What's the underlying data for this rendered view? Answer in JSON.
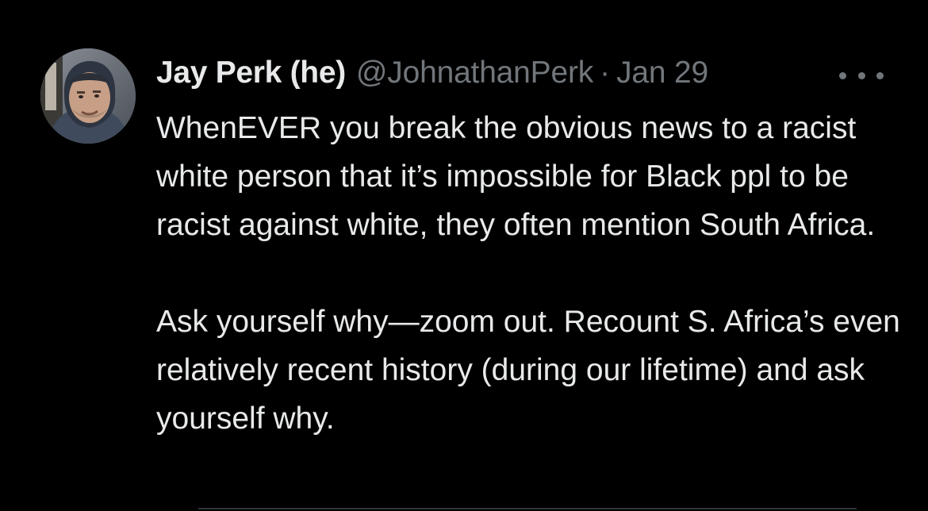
{
  "tweet": {
    "author": {
      "display_name": "Jay Perk (he)",
      "handle": "@JohnathanPerk",
      "avatar_icon": "user-avatar-photo"
    },
    "separator": "·",
    "date": "Jan 29",
    "more_icon": "more-horizontal-icon",
    "paragraphs": [
      "WhenEVER you break the obvious news to a racist white person that it’s impossible for Black ppl to be racist against white, they often mention South Africa.",
      "Ask yourself why—zoom out. Recount S. Africa’s even relatively recent history (during our lifetime) and ask yourself why."
    ]
  },
  "colors": {
    "background": "#000000",
    "primary_text": "#e7e9ea",
    "secondary_text": "#71767b"
  }
}
